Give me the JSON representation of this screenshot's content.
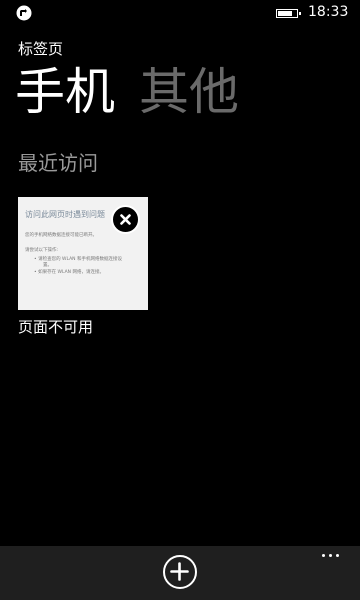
{
  "statusbar": {
    "time": "18:33",
    "battery_level": 0.85,
    "icon": "app-badge-icon"
  },
  "header": {
    "section_label": "标签页"
  },
  "pivot": {
    "items": [
      {
        "label": "手机"
      },
      {
        "label": "其他"
      }
    ]
  },
  "main": {
    "subheading": "最近访问",
    "tile": {
      "title": "访问此网页时遇到问题",
      "line1": "您的手机网络数据连接可能已断开。",
      "line2": "请尝试以下操作:",
      "bullet1a": "•  请检查您的 WLAN 和手机网络数据连接设",
      "bullet1b": "置。",
      "bullet2": "•  如果存在 WLAN 网络，请连接。",
      "caption": "页面不可用",
      "close_icon": "close-icon"
    }
  },
  "appbar": {
    "add_icon": "add-icon",
    "more_icon": "more-icon"
  },
  "colors": {
    "background": "#000000",
    "inactive_pivot": "#6a6a6a",
    "appbar": "#1f1f1f",
    "tile": "#f2f2f2"
  }
}
